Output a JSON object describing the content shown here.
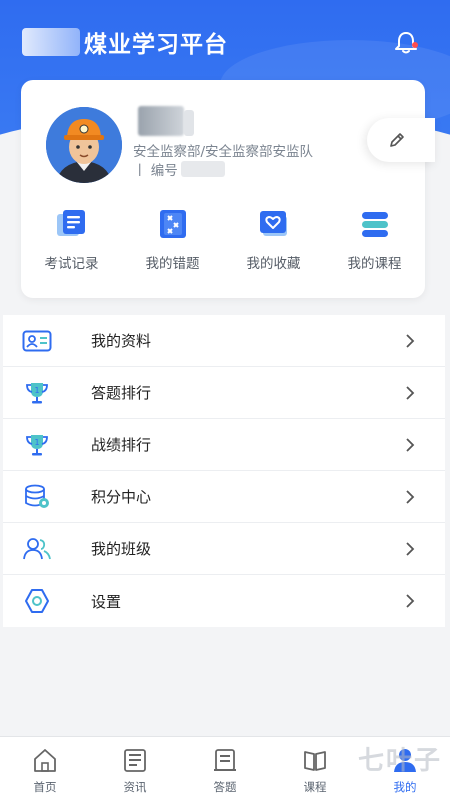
{
  "header": {
    "title": "煤业学习平台",
    "bell_icon": "bell-icon",
    "notification_dot_color": "#ff4d4f"
  },
  "profile": {
    "department": "安全监察部/安全监察部安监队",
    "code_label": "丨 编号",
    "edit_icon": "pencil-icon"
  },
  "quick_actions": [
    {
      "label": "考试记录",
      "icon": "exam-record-icon"
    },
    {
      "label": "我的错题",
      "icon": "wrong-questions-icon"
    },
    {
      "label": "我的收藏",
      "icon": "favorites-icon"
    },
    {
      "label": "我的课程",
      "icon": "courses-icon"
    }
  ],
  "menu": [
    {
      "label": "我的资料",
      "icon": "profile-card-icon"
    },
    {
      "label": "答题排行",
      "icon": "trophy-icon"
    },
    {
      "label": "战绩排行",
      "icon": "trophy-icon"
    },
    {
      "label": "积分中心",
      "icon": "points-icon"
    },
    {
      "label": "我的班级",
      "icon": "class-users-icon"
    },
    {
      "label": "设置",
      "icon": "settings-icon"
    }
  ],
  "tabbar": {
    "items": [
      {
        "label": "首页",
        "icon": "home-icon",
        "active": false
      },
      {
        "label": "资讯",
        "icon": "news-icon",
        "active": false
      },
      {
        "label": "答题",
        "icon": "answer-icon",
        "active": false
      },
      {
        "label": "课程",
        "icon": "course-icon",
        "active": false
      },
      {
        "label": "我的",
        "icon": "user-icon",
        "active": true
      }
    ]
  },
  "watermark": "七叶子",
  "colors": {
    "primary": "#2f6cf0",
    "background": "#f3f4f6"
  }
}
